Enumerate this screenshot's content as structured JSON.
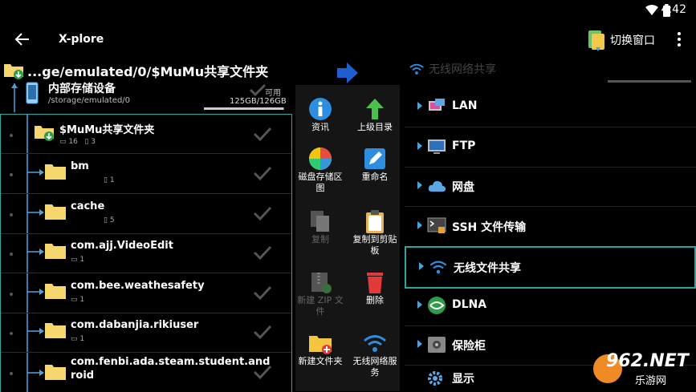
{
  "status": {
    "time": "4:42"
  },
  "appbar": {
    "title": "X-plore",
    "switch_label": "切换窗口"
  },
  "left": {
    "path": "...ge/emulated/0/$MuMu共享文件夹",
    "storage": {
      "name": "内部存储设备",
      "path": "/storage/emulated/0",
      "avail_label": "可用",
      "size": "125GB/126GB"
    },
    "root_folder": {
      "name": "$MuMu共享文件夹",
      "dirs": "16",
      "files": "3"
    },
    "folders": [
      {
        "name": "bm",
        "count": "1"
      },
      {
        "name": "cache",
        "count": "5"
      },
      {
        "name": "com.ajj.VideoEdit",
        "count": "1"
      },
      {
        "name": "com.bee.weathesafety",
        "count": "1"
      },
      {
        "name": "com.dabanjia.rikiuser",
        "count": "1"
      },
      {
        "name": "com.fenbi.ada.steam.student.and",
        "name2": "roid"
      }
    ]
  },
  "ops": {
    "info": "资讯",
    "parent": "上级目录",
    "disk_map": "磁盘存储区图",
    "rename": "重命名",
    "copy": "复制",
    "copy_clip": "复制到剪贴板",
    "new_zip": "新建 ZIP 文件",
    "delete": "删除",
    "new_folder": "新建文件夹",
    "wifi_service": "无线网络服务"
  },
  "right": {
    "header": "无线网络共享",
    "items": [
      {
        "label": "LAN"
      },
      {
        "label": "FTP"
      },
      {
        "label": "网盘"
      },
      {
        "label": "SSH 文件传输"
      },
      {
        "label": "无线文件共享"
      },
      {
        "label": "DLNA"
      },
      {
        "label": "保险柜"
      },
      {
        "label": "显示"
      }
    ]
  },
  "watermark": {
    "main": "962.NET",
    "sub": "乐游网"
  },
  "colors": {
    "accent": "#2aa7a0",
    "folder": "#f5d76e",
    "blue": "#4aa3df"
  }
}
